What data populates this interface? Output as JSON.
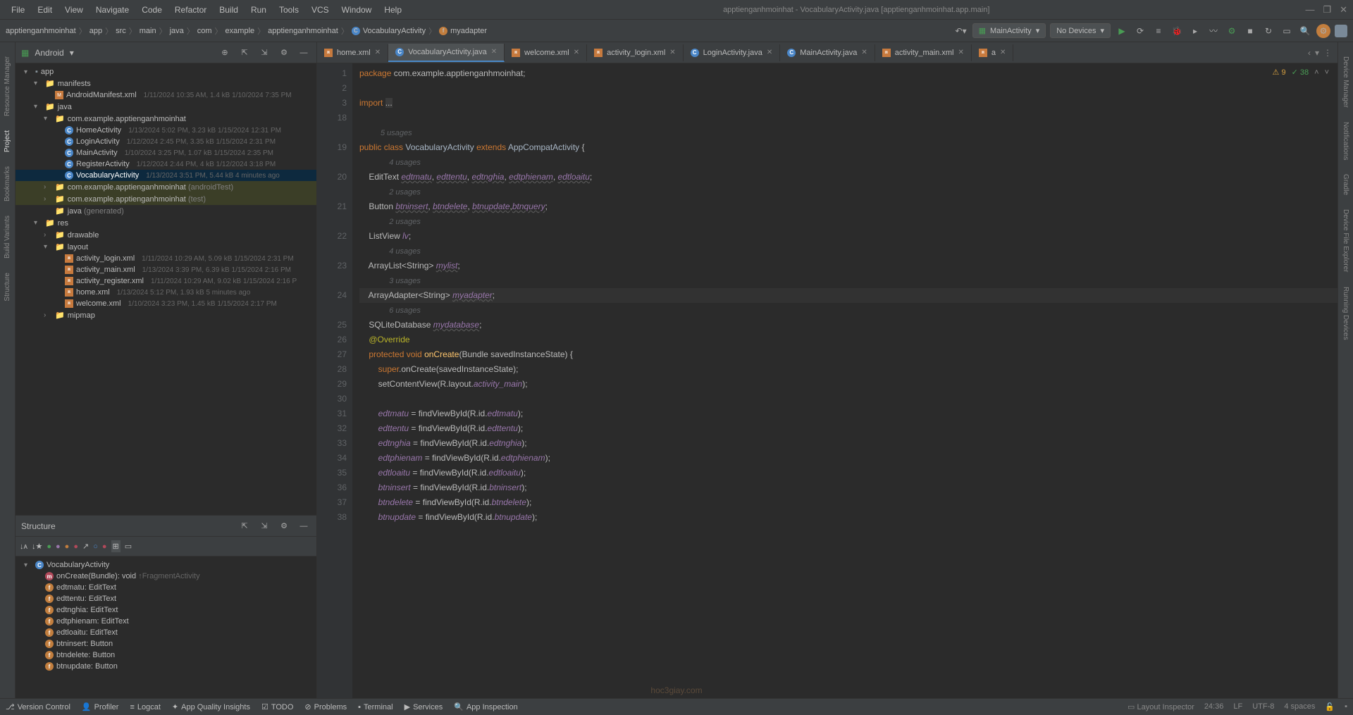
{
  "window": {
    "title": "apptienganhmoinhat - VocabularyActivity.java [apptienganhmoinhat.app.main]"
  },
  "menu": {
    "file": "File",
    "edit": "Edit",
    "view": "View",
    "navigate": "Navigate",
    "code": "Code",
    "refactor": "Refactor",
    "build": "Build",
    "run": "Run",
    "tools": "Tools",
    "vcs": "VCS",
    "window": "Window",
    "help": "Help"
  },
  "breadcrumb": {
    "items": [
      "apptienganhmoinhat",
      "app",
      "src",
      "main",
      "java",
      "com",
      "example",
      "apptienganhmoinhat"
    ],
    "class": "VocabularyActivity",
    "field": "myadapter"
  },
  "run_config": {
    "selected": "MainActivity",
    "device": "No Devices"
  },
  "project_panel": {
    "label": "Android"
  },
  "project_tree": {
    "root": "app",
    "manifests": "manifests",
    "manifest_file": "AndroidManifest.xml",
    "manifest_meta": "1/11/2024 10:35 AM, 1.4 kB 1/10/2024 7:35 PM",
    "java": "java",
    "pkg": "com.example.apptienganhmoinhat",
    "files": [
      {
        "name": "HomeActivity",
        "meta": "1/13/2024 5:02 PM, 3.23 kB 1/15/2024 12:31 PM"
      },
      {
        "name": "LoginActivity",
        "meta": "1/12/2024 2:45 PM, 3.35 kB 1/15/2024 2:31 PM"
      },
      {
        "name": "MainActivity",
        "meta": "1/10/2024 3:25 PM, 1.07 kB 1/15/2024 2:35 PM"
      },
      {
        "name": "RegisterActivity",
        "meta": "1/12/2024 2:44 PM, 4 kB 1/12/2024 3:18 PM"
      },
      {
        "name": "VocabularyActivity",
        "meta": "1/13/2024 3:51 PM, 5.44 kB 4 minutes ago"
      }
    ],
    "android_test": "com.example.apptienganhmoinhat",
    "android_test_suffix": "(androidTest)",
    "test": "com.example.apptienganhmoinhat",
    "test_suffix": "(test)",
    "java_gen": "java",
    "java_gen_suffix": "(generated)",
    "res": "res",
    "drawable": "drawable",
    "layout": "layout",
    "layouts": [
      {
        "name": "activity_login.xml",
        "meta": "1/11/2024 10:29 AM, 5.09 kB 1/15/2024 2:31 PM"
      },
      {
        "name": "activity_main.xml",
        "meta": "1/13/2024 3:39 PM, 6.39 kB 1/15/2024 2:16 PM"
      },
      {
        "name": "activity_register.xml",
        "meta": "1/11/2024 10:29 AM, 9.02 kB 1/15/2024 2:16 P"
      },
      {
        "name": "home.xml",
        "meta": "1/13/2024 5:12 PM, 1.93 kB 5 minutes ago"
      },
      {
        "name": "welcome.xml",
        "meta": "1/10/2024 3:23 PM, 1.45 kB 1/15/2024 2:17 PM"
      }
    ],
    "mipmap": "mipmap"
  },
  "structure_panel": {
    "label": "Structure"
  },
  "structure_tree": {
    "class": "VocabularyActivity",
    "members": [
      {
        "name": "onCreate(Bundle): void",
        "from": "↑FragmentActivity",
        "icon": "m"
      },
      {
        "name": "edtmatu: EditText",
        "icon": "f"
      },
      {
        "name": "edttentu: EditText",
        "icon": "f"
      },
      {
        "name": "edtnghia: EditText",
        "icon": "f"
      },
      {
        "name": "edtphienam: EditText",
        "icon": "f"
      },
      {
        "name": "edtloaitu: EditText",
        "icon": "f"
      },
      {
        "name": "btninsert: Button",
        "icon": "f"
      },
      {
        "name": "btndelete: Button",
        "icon": "f"
      },
      {
        "name": "btnupdate: Button",
        "icon": "f"
      }
    ]
  },
  "tabs": [
    {
      "label": "home.xml",
      "icon": "xml"
    },
    {
      "label": "VocabularyActivity.java",
      "icon": "c",
      "active": true
    },
    {
      "label": "welcome.xml",
      "icon": "xml"
    },
    {
      "label": "activity_login.xml",
      "icon": "xml"
    },
    {
      "label": "LoginActivity.java",
      "icon": "c"
    },
    {
      "label": "MainActivity.java",
      "icon": "c"
    },
    {
      "label": "activity_main.xml",
      "icon": "xml"
    },
    {
      "label": "a",
      "icon": "xml"
    }
  ],
  "inspection": {
    "warnings": "9",
    "passes": "38"
  },
  "code_lines": [
    {
      "n": "1",
      "html": "<span class='kw'>package</span> com.example.apptienganhmoinhat;"
    },
    {
      "n": "2",
      "html": ""
    },
    {
      "n": "3",
      "html": "<span class='kw'>import</span> <span style='background:#3b3b3b'>...</span>"
    },
    {
      "n": "18",
      "html": ""
    },
    {
      "n": "",
      "html": "<span class='usage'>5 usages</span>"
    },
    {
      "n": "19",
      "html": "<span class='kw'>public class</span> <span class='cl'>VocabularyActivity</span> <span class='kw'>extends</span> <span class='cl'>AppCompatActivity</span> {"
    },
    {
      "n": "",
      "html": "<span class='usage'>    4 usages</span>"
    },
    {
      "n": "20",
      "html": "    EditText <span class='ital under'>edtmatu</span>, <span class='ital under'>edttentu</span>, <span class='ital under'>edtnghia</span>, <span class='ital under'>edtphienam</span>, <span class='ital under'>edtloaitu</span>;"
    },
    {
      "n": "",
      "html": "<span class='usage'>    2 usages</span>"
    },
    {
      "n": "21",
      "html": "    Button <span class='ital under'>btninsert</span>, <span class='ital under'>btndelete</span>, <span class='ital under'>btnupdate</span>,<span class='ital under'>btnquery</span>;"
    },
    {
      "n": "",
      "html": "<span class='usage'>    2 usages</span>"
    },
    {
      "n": "22",
      "html": "    ListView <span class='ital'>lv</span>;"
    },
    {
      "n": "",
      "html": "<span class='usage'>    4 usages</span>"
    },
    {
      "n": "23",
      "html": "    ArrayList&lt;String&gt; <span class='ital under'>mylist</span>;"
    },
    {
      "n": "",
      "html": "<span class='usage'>    3 usages</span>"
    },
    {
      "n": "24",
      "html": "    ArrayAdapter&lt;String&gt; <span class='ital under'>myadapter</span>;",
      "cursor": true
    },
    {
      "n": "",
      "html": "<span class='usage'>    6 usages</span>"
    },
    {
      "n": "25",
      "html": "    SQLiteDatabase <span class='ital under'>mydatabase</span>;"
    },
    {
      "n": "26",
      "html": "    <span class='annotation'>@Override</span>"
    },
    {
      "n": "27",
      "html": "    <span class='kw'>protected void</span> <span class='fn'>onCreate</span>(Bundle savedInstanceState) {"
    },
    {
      "n": "28",
      "html": "        <span class='kw'>super</span>.onCreate(savedInstanceState);"
    },
    {
      "n": "29",
      "html": "        setContentView(R.layout.<span class='ital'>activity_main</span>);"
    },
    {
      "n": "30",
      "html": ""
    },
    {
      "n": "31",
      "html": "        <span class='ital'>edtmatu</span> = findViewById(R.id.<span class='ital'>edtmatu</span>);"
    },
    {
      "n": "32",
      "html": "        <span class='ital'>edttentu</span> = findViewById(R.id.<span class='ital'>edttentu</span>);"
    },
    {
      "n": "33",
      "html": "        <span class='ital'>edtnghia</span> = findViewById(R.id.<span class='ital'>edtnghia</span>);"
    },
    {
      "n": "34",
      "html": "        <span class='ital'>edtphienam</span> = findViewById(R.id.<span class='ital'>edtphienam</span>);"
    },
    {
      "n": "35",
      "html": "        <span class='ital'>edtloaitu</span> = findViewById(R.id.<span class='ital'>edtloaitu</span>);"
    },
    {
      "n": "36",
      "html": "        <span class='ital'>btninsert</span> = findViewById(R.id.<span class='ital'>btninsert</span>);"
    },
    {
      "n": "37",
      "html": "        <span class='ital'>btndelete</span> = findViewById(R.id.<span class='ital'>btndelete</span>);"
    },
    {
      "n": "38",
      "html": "        <span class='ital'>btnupdate</span> = findViewById(R.id.<span class='ital'>btnupdate</span>);"
    }
  ],
  "bottom_tools": {
    "version_control": "Version Control",
    "profiler": "Profiler",
    "logcat": "Logcat",
    "quality": "App Quality Insights",
    "todo": "TODO",
    "problems": "Problems",
    "terminal": "Terminal",
    "services": "Services",
    "inspection": "App Inspection",
    "layout_inspector": "Layout Inspector"
  },
  "status": {
    "pos": "24:36",
    "sep": "LF",
    "enc": "UTF-8",
    "indent": "4 spaces"
  },
  "left_rail": {
    "resource_manager": "Resource Manager",
    "project": "Project",
    "bookmarks": "Bookmarks",
    "build_variants": "Build Variants",
    "structure": "Structure"
  },
  "right_rail": {
    "device_manager": "Device Manager",
    "notifications": "Notifications",
    "gradle": "Gradle",
    "device_explorer": "Device File Explorer",
    "running_devices": "Running Devices"
  },
  "watermark": "hoc3giay.com"
}
